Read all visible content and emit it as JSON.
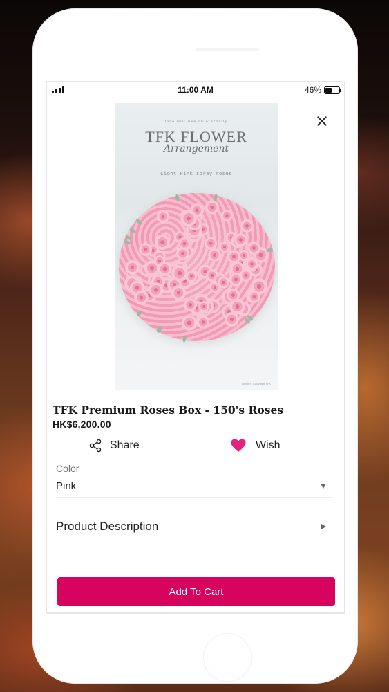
{
  "status_bar": {
    "time": "11:00 AM",
    "battery_percent": "46%",
    "battery_level": 0.46
  },
  "product_image": {
    "tagline": "love will live on eternally",
    "brand": "TFK FLOWER",
    "script": "Arrangement",
    "caption": "Light Pink spray roses",
    "credit": "Design • Copyright TFK"
  },
  "product": {
    "title": "TFK Premium Roses Box - 150's Roses",
    "price": "HK$6,200.00"
  },
  "actions": {
    "share_label": "Share",
    "share_icon": "share-icon",
    "wish_label": "Wish",
    "wish_icon": "heart-icon"
  },
  "color": {
    "label": "Color",
    "selected": "Pink"
  },
  "description": {
    "label": "Product Description"
  },
  "cart": {
    "button_label": "Add To Cart"
  },
  "colors": {
    "accent": "#d6035f",
    "heart": "#e6227e"
  }
}
